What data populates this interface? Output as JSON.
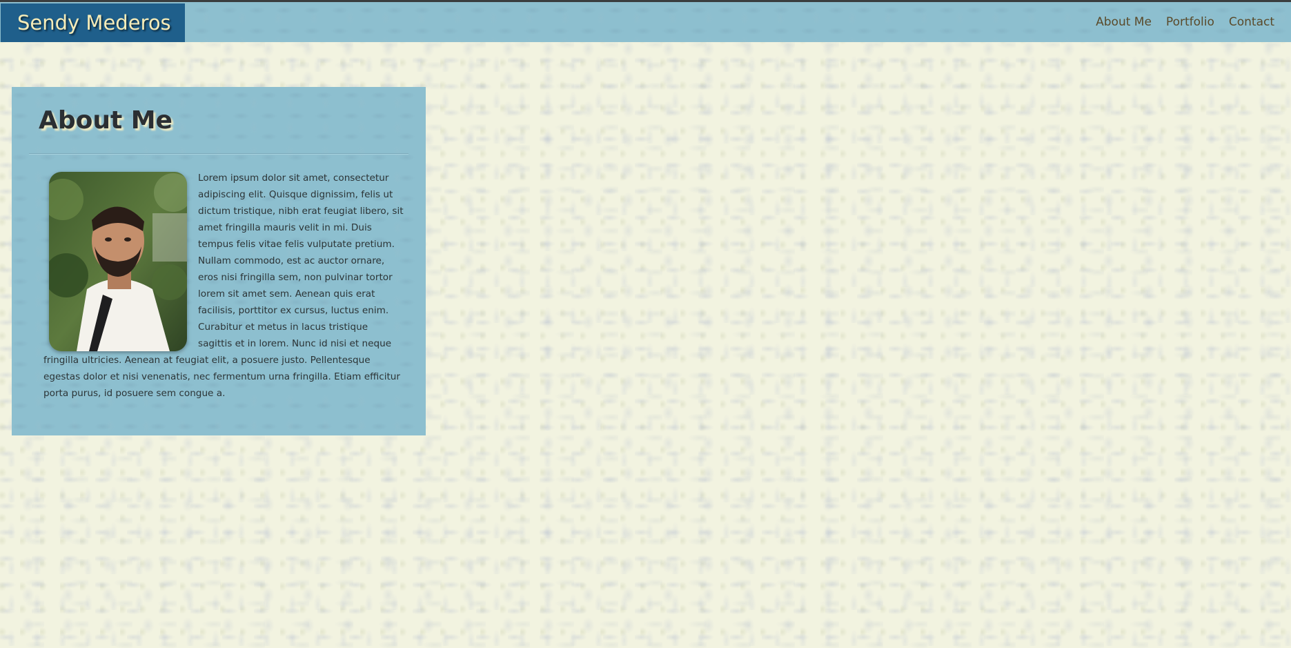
{
  "navbar": {
    "brand": "Sendy Mederos",
    "links": [
      "About Me",
      "Portfolio",
      "Contact"
    ]
  },
  "about": {
    "heading": "About Me",
    "photo_alt": "profile-photo",
    "paragraph": "Lorem ipsum dolor sit amet, consectetur adipiscing elit. Quisque dignissim, felis ut dictum tristique, nibh erat feugiat libero, sit amet fringilla mauris velit in mi. Duis tempus felis vitae felis vulputate pretium. Nullam commodo, est ac auctor ornare, eros nisi fringilla sem, non pulvinar tortor lorem sit amet sem. Aenean quis erat facilisis, porttitor ex cursus, luctus enim. Curabitur et metus in lacus tristique sagittis et in lorem. Nunc id nisi et neque fringilla ultricies. Aenean at feugiat elit, a posuere justo. Pellentesque egestas dolor et nisi venenatis, nec fermentum urna fringilla. Etiam efficitur porta purus, id posuere sem congue a."
  },
  "colors": {
    "page_background": "#f2f3e0",
    "navbar_background": "#8dbfcf",
    "brand_background": "#1f5f8b",
    "brand_text": "#f6ecb8",
    "panel_background": "#8dbfcf",
    "nav_link_text": "#5a4a2a"
  }
}
